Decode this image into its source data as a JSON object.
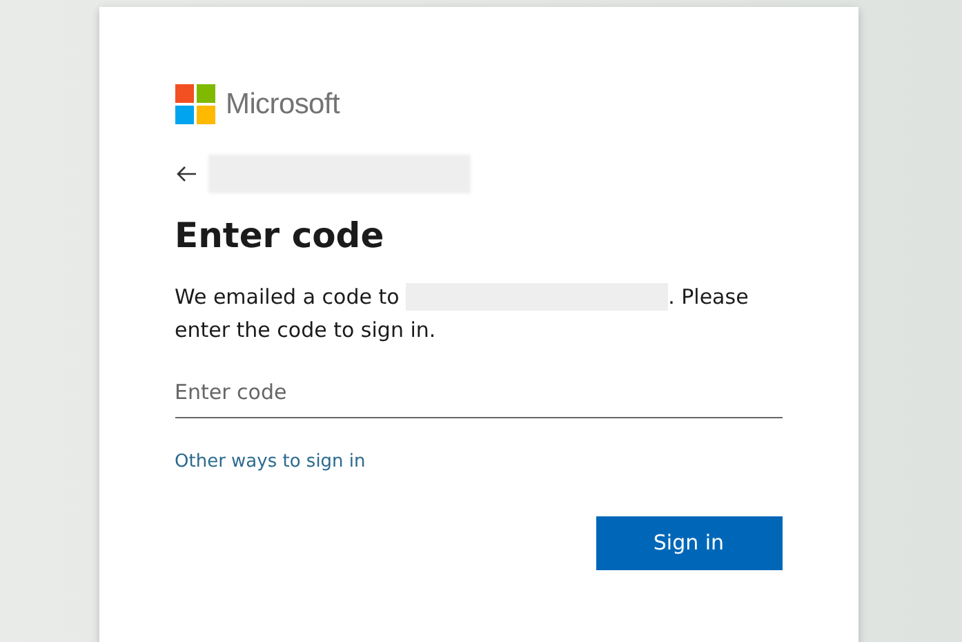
{
  "brand": {
    "name": "Microsoft"
  },
  "heading": "Enter code",
  "message": {
    "before": "We emailed a code to",
    "after": ". Please enter the code to sign in."
  },
  "code_field": {
    "placeholder": "Enter code"
  },
  "link": "Other ways to sign in",
  "buttons": [
    "Sign in"
  ]
}
